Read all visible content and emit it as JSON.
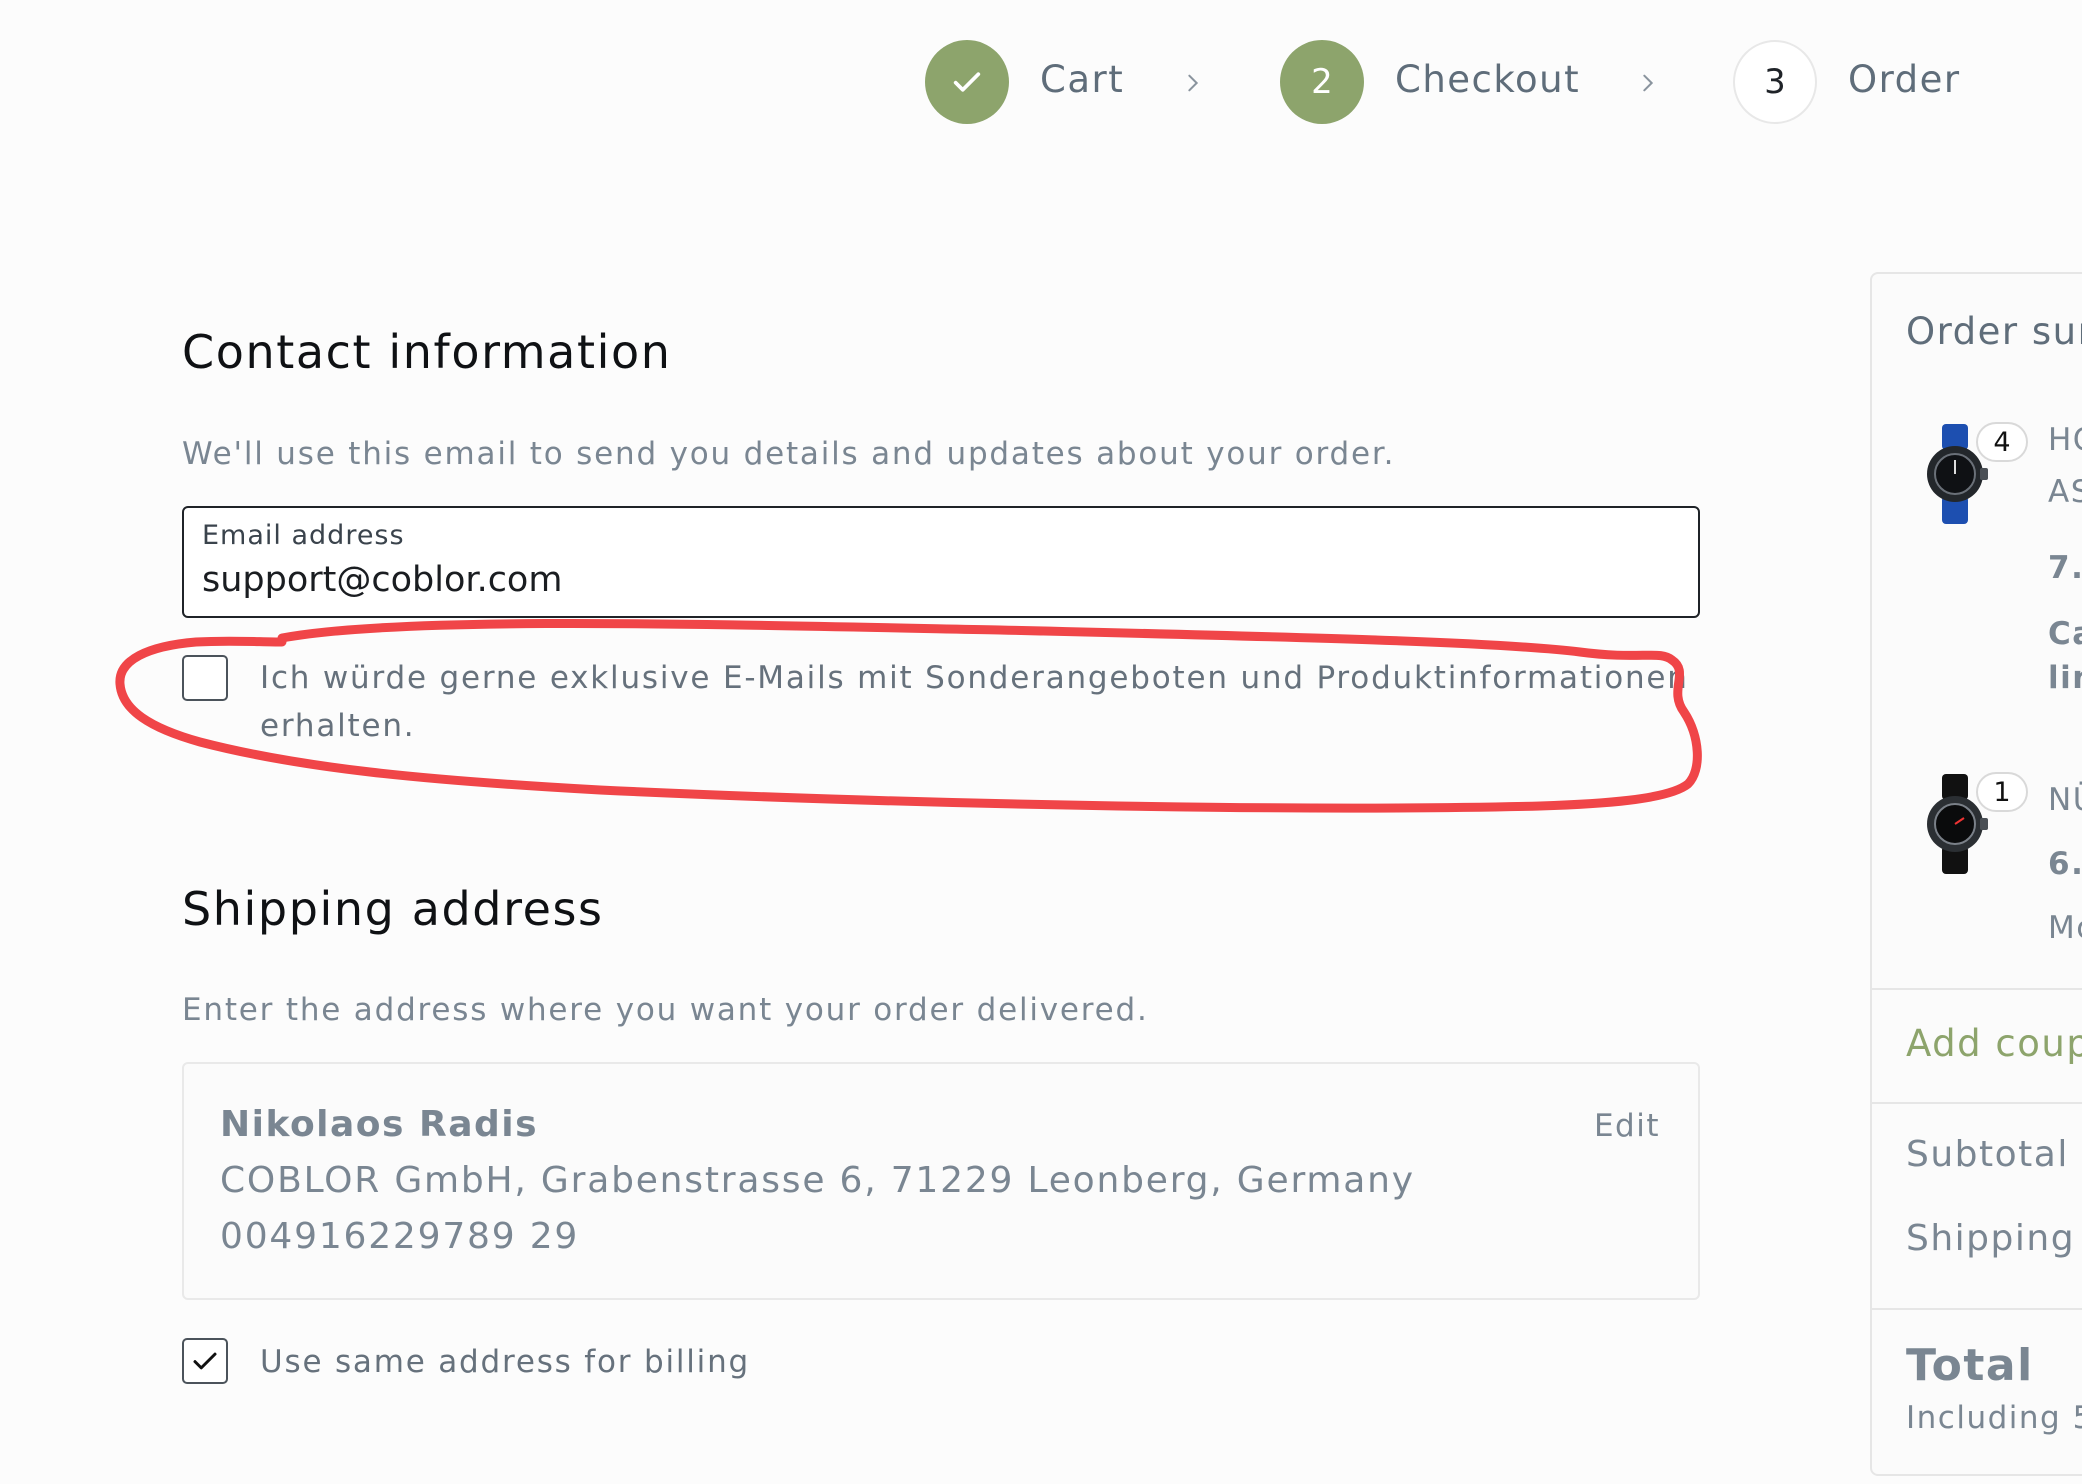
{
  "steps": [
    {
      "label": "Cart",
      "marker": "✓"
    },
    {
      "label": "Checkout",
      "marker": "2"
    },
    {
      "label": "Order",
      "marker": "3"
    }
  ],
  "contact": {
    "title": "Contact information",
    "description": "We'll use this email to send you details and updates about your order.",
    "email_label": "Email address",
    "email_value": "support@coblor.com",
    "newsletter_line1": "Ich würde gerne exklusive E-Mails mit Sonderangeboten und Produktinformationen",
    "newsletter_line2": "erhalten."
  },
  "shipping": {
    "title": "Shipping address",
    "description": "Enter the address where you want your order delivered.",
    "name": "Nikolaos Radis",
    "address": "COBLOR GmbH, Grabenstrasse 6, 71229 Leonberg, Germany",
    "phone": "004916229789 29",
    "edit_label": "Edit",
    "billing_same_label": "Use same address for billing"
  },
  "summary": {
    "title": "Order sur",
    "items": [
      {
        "qty": "4",
        "name1": "HC",
        "name2": "AS",
        "price": "7.(",
        "extra1": "Ca",
        "extra2": "lin"
      },
      {
        "qty": "1",
        "name1": "NÜ",
        "price": "6.:",
        "extra1": "Mc"
      }
    ],
    "coupon_label": "Add coup",
    "subtotal_label": "Subtotal",
    "shipping_label": "Shipping",
    "total_label": "Total",
    "including_label": "Including 5"
  },
  "annotation": {
    "color": "#f04548"
  },
  "colors": {
    "accent_green": "#8da46c"
  }
}
